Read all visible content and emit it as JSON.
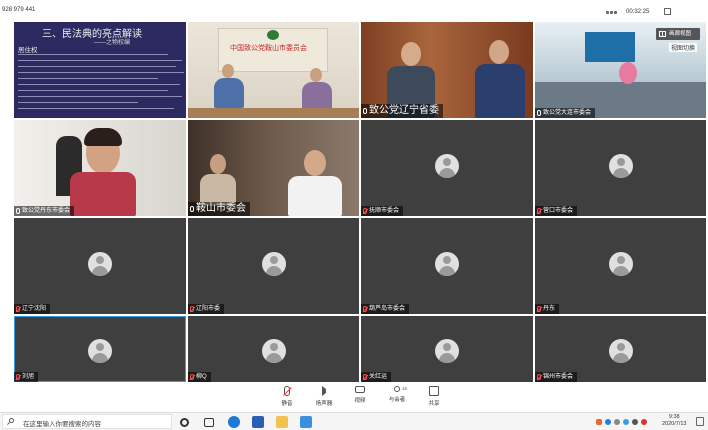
{
  "meeting": {
    "id": "928 979 441",
    "elapsed": "00:32:25",
    "gallery_view_label": "画廊视图",
    "view_switch_label": "视图切换"
  },
  "slide": {
    "title": "三、民法典的亮点解读",
    "subtitle": "——之物权编",
    "heading": "居住权"
  },
  "tiles": [
    {
      "label": "",
      "mic_muted": false
    },
    {
      "label": "",
      "banner": "中国致公党鞍山市委员会",
      "mic_muted": false
    },
    {
      "label": "致公党辽宁省委",
      "mic_muted": false
    },
    {
      "label": "致公党大连市委会",
      "mic_muted": false
    },
    {
      "label": "致公党丹东市委会",
      "mic_muted": false
    },
    {
      "label": "鞍山市委会",
      "mic_muted": false
    },
    {
      "label": "抚顺市委会",
      "mic_muted": true
    },
    {
      "label": "营口市委会",
      "mic_muted": true
    },
    {
      "label": "辽宁沈阳",
      "mic_muted": true
    },
    {
      "label": "辽阳市委",
      "mic_muted": true
    },
    {
      "label": "葫芦岛市委会",
      "mic_muted": true
    },
    {
      "label": "丹东",
      "mic_muted": true
    },
    {
      "label": "刘旭",
      "mic_muted": true
    },
    {
      "label": "柳Q",
      "mic_muted": true
    },
    {
      "label": "关红运",
      "mic_muted": true
    },
    {
      "label": "锦州市委会",
      "mic_muted": true
    }
  ],
  "toolbar": {
    "mute_label": "静音",
    "speaker_label": "扬声器",
    "video_label": "视频",
    "participants_label": "与会者",
    "participants_count": "16",
    "share_label": "共享"
  },
  "taskbar": {
    "search_placeholder": "在这里输入你要搜索的内容",
    "time": "9:38",
    "date": "2020/7/13"
  },
  "colors": {
    "tile_bg": "#3f3f3f",
    "slide_bg": "#2c2a60",
    "highlight": "#3a9be0",
    "muted_mic": "#ff4e4e"
  }
}
